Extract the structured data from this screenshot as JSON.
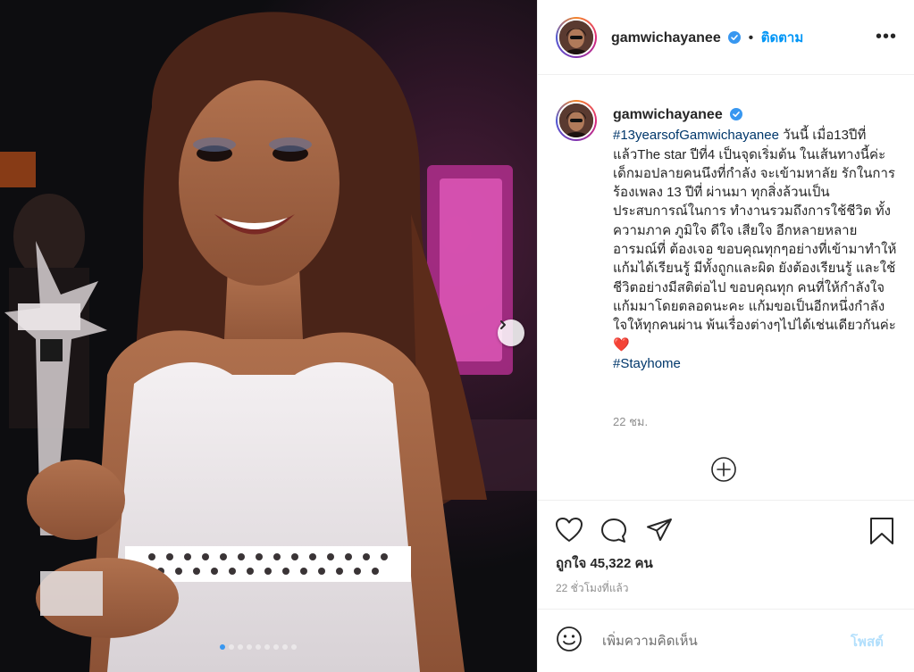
{
  "post": {
    "image_alt": "woman smiling holding a trophy"
  },
  "carousel": {
    "next_icon": "chevron-right-icon",
    "dot_count": 9,
    "active_dot": 0
  },
  "header": {
    "username": "gamwichayanee",
    "separator": "•",
    "follow_label": "ติดตาม",
    "more_label": "•••"
  },
  "caption": {
    "username": "gamwichayanee",
    "hashtag1": "#13yearsofGamwichayanee",
    "text": " วันนี้ เมื่อ13ปีที่แล้วThe star ปีที่4 เป็นจุดเริ่มต้น ในเส้นทางนี้ค่ะ เด็กมอปลายคนนึงที่กำลัง จะเข้ามหาลัย รักในการร้องเพลง 13 ปีที่ ผ่านมา ทุกสิ่งล้วนเป็นประสบการณ์ในการ ทำงานรวมถึงการใช้ชีวิต ทั้งความภาค ภูมิใจ ดีใจ เสียใจ อีกหลายหลายอารมณ์ที่ ต้องเจอ ขอบคุณทุกๆอย่างที่เข้ามาทำให้ แก้มได้เรียนรู้ มีทั้งถูกและผิด ยังต้องเรียนรู้ และใช้ชีวิตอย่างมีสติต่อไป ขอบคุณทุก คนที่ให้กำลังใจแก้มมาโดยตลอดนะคะ แก้มขอเป็นอีกหนึ่งกำลังใจให้ทุกคนผ่าน พ้นเรื่องต่างๆไปได้เช่นเดียวกันค่ะ",
    "emoji": "❤️",
    "hashtag2": "#Stayhome",
    "time": "22 ชม."
  },
  "actions": {
    "likes": "ถูกใจ 45,322 คน",
    "posted_ago": "22 ชั่วโมงที่แล้ว"
  },
  "comment": {
    "placeholder": "เพิ่มความคิดเห็น",
    "post_label": "โพสต์"
  },
  "colors": {
    "link": "#0095f6",
    "hashtag": "#00376b",
    "active_dot": "#3897f0",
    "heart": "#ed4956"
  }
}
